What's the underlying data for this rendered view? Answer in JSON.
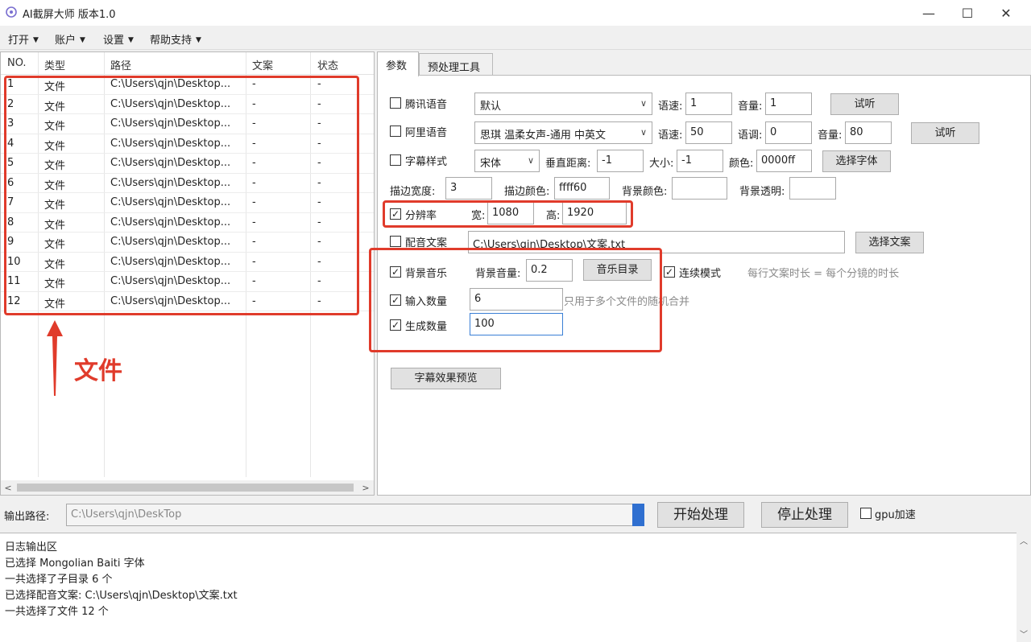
{
  "window": {
    "title": "AI截屏大师  版本1.0",
    "controls": {
      "minimize": "—",
      "maximize": "☐",
      "close": "✕"
    }
  },
  "menu": [
    "打开",
    "账户",
    "设置",
    "帮助支持"
  ],
  "table": {
    "headers": [
      "NO.",
      "类型",
      "路径",
      "文案",
      "状态"
    ],
    "rows": [
      [
        "1",
        "文件",
        "C:\\Users\\qjn\\Desktop...",
        "-",
        "-"
      ],
      [
        "2",
        "文件",
        "C:\\Users\\qjn\\Desktop...",
        "-",
        "-"
      ],
      [
        "3",
        "文件",
        "C:\\Users\\qjn\\Desktop...",
        "-",
        "-"
      ],
      [
        "4",
        "文件",
        "C:\\Users\\qjn\\Desktop...",
        "-",
        "-"
      ],
      [
        "5",
        "文件",
        "C:\\Users\\qjn\\Desktop...",
        "-",
        "-"
      ],
      [
        "6",
        "文件",
        "C:\\Users\\qjn\\Desktop...",
        "-",
        "-"
      ],
      [
        "7",
        "文件",
        "C:\\Users\\qjn\\Desktop...",
        "-",
        "-"
      ],
      [
        "8",
        "文件",
        "C:\\Users\\qjn\\Desktop...",
        "-",
        "-"
      ],
      [
        "9",
        "文件",
        "C:\\Users\\qjn\\Desktop...",
        "-",
        "-"
      ],
      [
        "10",
        "文件",
        "C:\\Users\\qjn\\Desktop...",
        "-",
        "-"
      ],
      [
        "11",
        "文件",
        "C:\\Users\\qjn\\Desktop...",
        "-",
        "-"
      ],
      [
        "12",
        "文件",
        "C:\\Users\\qjn\\Desktop...",
        "-",
        "-"
      ]
    ]
  },
  "annotation": {
    "label": "文件",
    "color": "#e03b2b"
  },
  "tabs": [
    "参数",
    "预处理工具"
  ],
  "params": {
    "tencent": {
      "label": "腾讯语音",
      "checked": false,
      "voice": "默认",
      "speed_label": "语速:",
      "speed": "1",
      "volume_label": "音量:",
      "volume": "1",
      "button": "试听"
    },
    "ali": {
      "label": "阿里语音",
      "checked": false,
      "voice": "思琪 温柔女声-通用 中英文",
      "speed_label": "语速:",
      "speed": "50",
      "pitch_label": "语调:",
      "pitch": "0",
      "volume_label": "音量:",
      "volume": "80",
      "button": "试听"
    },
    "subtitle": {
      "label": "字幕样式",
      "checked": false,
      "font": "宋体",
      "vdist_label": "垂直距离:",
      "vdist": "-1",
      "size_label": "大小:",
      "size": "-1",
      "color_label": "颜色:",
      "color": "0000ff",
      "button": "选择字体"
    },
    "border": {
      "width_label": "描边宽度:",
      "width": "3",
      "color_label": "描边颜色:",
      "color": "ffff60",
      "bg_color_label": "背景颜色:",
      "bg_color": "",
      "bg_alpha_label": "背景透明:",
      "bg_alpha": ""
    },
    "resolution": {
      "label": "分辨率",
      "checked": true,
      "w_label": "宽:",
      "w": "1080",
      "h_label": "高:",
      "h": "1920"
    },
    "caption": {
      "label": "配音文案",
      "checked": false,
      "path": "C:\\Users\\qjn\\Desktop\\文案.txt",
      "button": "选择文案"
    },
    "bgm": {
      "label": "背景音乐",
      "checked": true,
      "volume_label": "背景音量:",
      "volume": "0.2",
      "button": "音乐目录",
      "continuous_label": "连续模式",
      "continuous_checked": true,
      "hint": "每行文案时长 = 每个分镜的时长"
    },
    "input_count": {
      "label": "输入数量",
      "checked": true,
      "value": "6",
      "hint": "只用于多个文件的随机合并"
    },
    "gen_count": {
      "label": "生成数量",
      "checked": true,
      "value": "100"
    },
    "preview_button": "字幕效果预览"
  },
  "output": {
    "label": "输出路径:",
    "path": "C:\\Users\\qjn\\DeskTop",
    "start_button": "开始处理",
    "stop_button": "停止处理",
    "gpu_label": "gpu加速",
    "gpu_checked": false
  },
  "log": [
    "日志输出区",
    "已选择 Mongolian Baiti 字体",
    "一共选择了子目录 6 个",
    "已选择配音文案: C:\\Users\\qjn\\Desktop\\文案.txt",
    "一共选择了文件 12 个"
  ]
}
